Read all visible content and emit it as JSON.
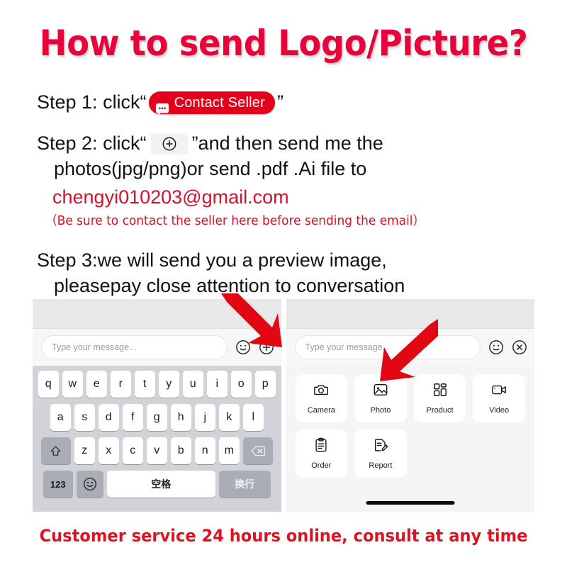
{
  "title": "How to send Logo/Picture?",
  "steps": {
    "step1": {
      "prefix": "Step 1: click“",
      "badge_label": "Contact Seller",
      "badge_icon": "chat-bubble-icon",
      "suffix": "”"
    },
    "step2": {
      "prefix": "Step 2: click“",
      "icon": "plus-circle-icon",
      "suffix": "”and then send me the",
      "line2": "photos(jpg/png)or send .pdf .Ai file to",
      "email": "chengyi010203@gmail.com",
      "note": "（Be sure to contact the seller here before sending the email）"
    },
    "step3": {
      "line1": "Step 3:we will send you a preview image,",
      "line2": "pleasepay close attention to conversation"
    }
  },
  "left_panel": {
    "input_placeholder": "Type your message...",
    "emoji_icon": "smiley-icon",
    "plus_icon": "plus-circle-icon",
    "keyboard": {
      "row1": [
        "q",
        "w",
        "e",
        "r",
        "t",
        "y",
        "u",
        "i",
        "o",
        "p"
      ],
      "row2": [
        "a",
        "s",
        "d",
        "f",
        "g",
        "h",
        "j",
        "k",
        "l"
      ],
      "row3": [
        "z",
        "x",
        "c",
        "v",
        "b",
        "n",
        "m"
      ],
      "shift_icon": "shift-up-arrow-icon",
      "backspace_icon": "backspace-icon",
      "num_key": "123",
      "emoji_key_icon": "emoji-face-icon",
      "space_key": "空格",
      "enter_key": "换行"
    }
  },
  "right_panel": {
    "input_placeholder": "Type your message...",
    "emoji_icon": "smiley-icon",
    "close_icon": "close-circle-icon",
    "actions": [
      {
        "label": "Camera",
        "icon": "camera-icon"
      },
      {
        "label": "Photo",
        "icon": "photo-image-icon"
      },
      {
        "label": "Product",
        "icon": "product-grid-icon"
      },
      {
        "label": "Video",
        "icon": "video-camera-icon"
      },
      {
        "label": "Order",
        "icon": "clipboard-order-icon"
      },
      {
        "label": "Report",
        "icon": "report-edit-icon"
      }
    ]
  },
  "annotations": {
    "left_arrow": "red-arrow-pointing-to-plus-button",
    "right_arrow": "red-arrow-pointing-to-photo-option"
  },
  "footer": "Customer service 24 hours online, consult at any time",
  "colors": {
    "brand_red": "#E3001B",
    "title_red": "#E8033A",
    "footer_red": "#E21122",
    "text_black": "#121212"
  }
}
